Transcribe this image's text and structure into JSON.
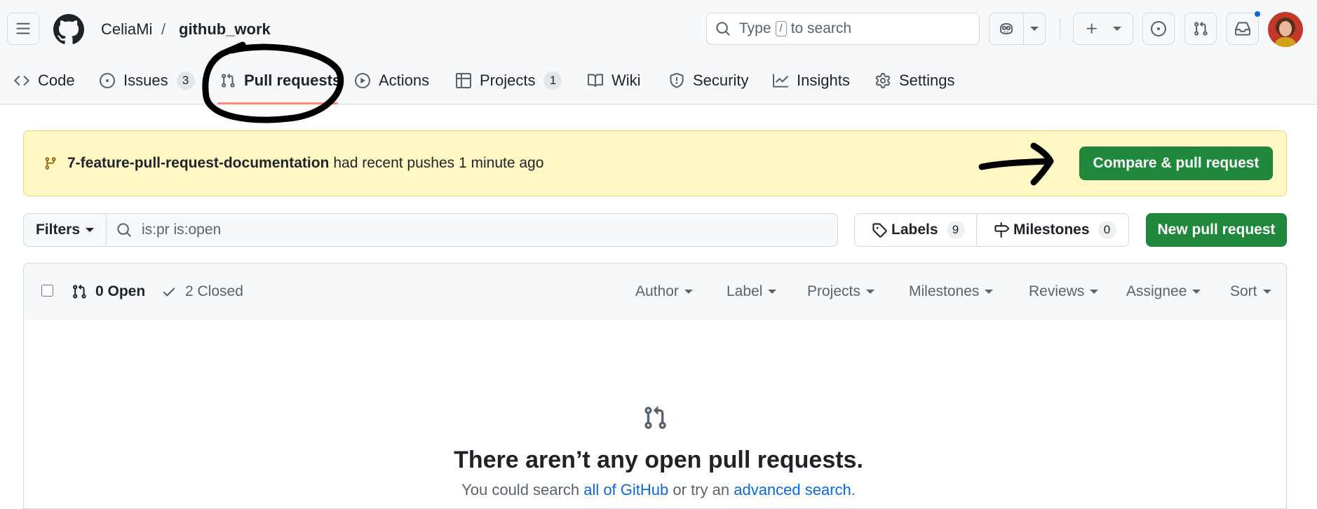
{
  "header": {
    "owner": "CeliaMi",
    "separator": "/",
    "repo": "github_work",
    "search_prefix": "Type",
    "search_key": "/",
    "search_suffix": "to search"
  },
  "tabs": [
    {
      "label": "Code",
      "icon": "code-icon"
    },
    {
      "label": "Issues",
      "count": "3",
      "icon": "issue-opened-icon"
    },
    {
      "label": "Pull requests",
      "icon": "git-pull-request-icon",
      "selected": true
    },
    {
      "label": "Actions",
      "icon": "play-icon"
    },
    {
      "label": "Projects",
      "count": "1",
      "icon": "table-icon"
    },
    {
      "label": "Wiki",
      "icon": "book-icon"
    },
    {
      "label": "Security",
      "icon": "shield-icon"
    },
    {
      "label": "Insights",
      "icon": "graph-icon"
    },
    {
      "label": "Settings",
      "icon": "gear-icon"
    }
  ],
  "banner": {
    "branch": "7-feature-pull-request-documentation",
    "message": "had recent pushes 1 minute ago",
    "button": "Compare & pull request"
  },
  "filters": {
    "button": "Filters",
    "query": "is:pr is:open",
    "labels_label": "Labels",
    "labels_count": "9",
    "milestones_label": "Milestones",
    "milestones_count": "0",
    "new_pr": "New pull request"
  },
  "list_header": {
    "open": "0 Open",
    "closed": "2 Closed",
    "sorts": [
      "Author",
      "Label",
      "Projects",
      "Milestones",
      "Reviews",
      "Assignee",
      "Sort"
    ]
  },
  "blankslate": {
    "title": "There aren’t any open pull requests.",
    "sub_before": "You could search",
    "link1": "all of GitHub",
    "sub_middle": "or try an",
    "link2": "advanced search",
    "sub_after": "."
  },
  "colors": {
    "accent_green": "#1f883d",
    "banner_bg": "#fff8c5",
    "selected_tab_underline": "#fd8c73",
    "link_blue": "#0969da"
  }
}
